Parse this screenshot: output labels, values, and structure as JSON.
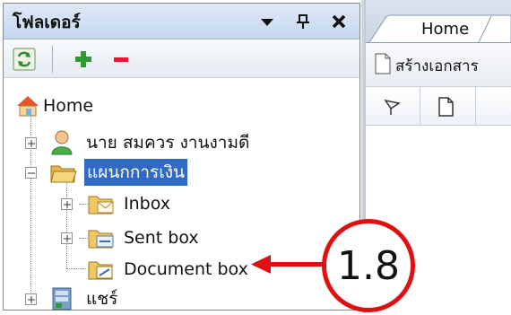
{
  "panel": {
    "title": "โฟลเดอร์",
    "title_buttons": [
      "dropdown-arrow-icon",
      "pin-icon",
      "close-icon"
    ],
    "toolbar": [
      "refresh-icon",
      "add-icon",
      "remove-icon"
    ]
  },
  "tree": {
    "home": "Home",
    "user": "นาย สมควร งานงามดี",
    "folder_plan": "แผนกการเงิน",
    "inbox": "Inbox",
    "sent": "Sent box",
    "document": "Document box",
    "share": "แชร์"
  },
  "right": {
    "tab_home": "Home",
    "create_doc": "สร้างเอกสาร"
  },
  "callout": {
    "label": "1.8"
  },
  "colors": {
    "selection": "#316ac5",
    "callout": "#e01010"
  }
}
